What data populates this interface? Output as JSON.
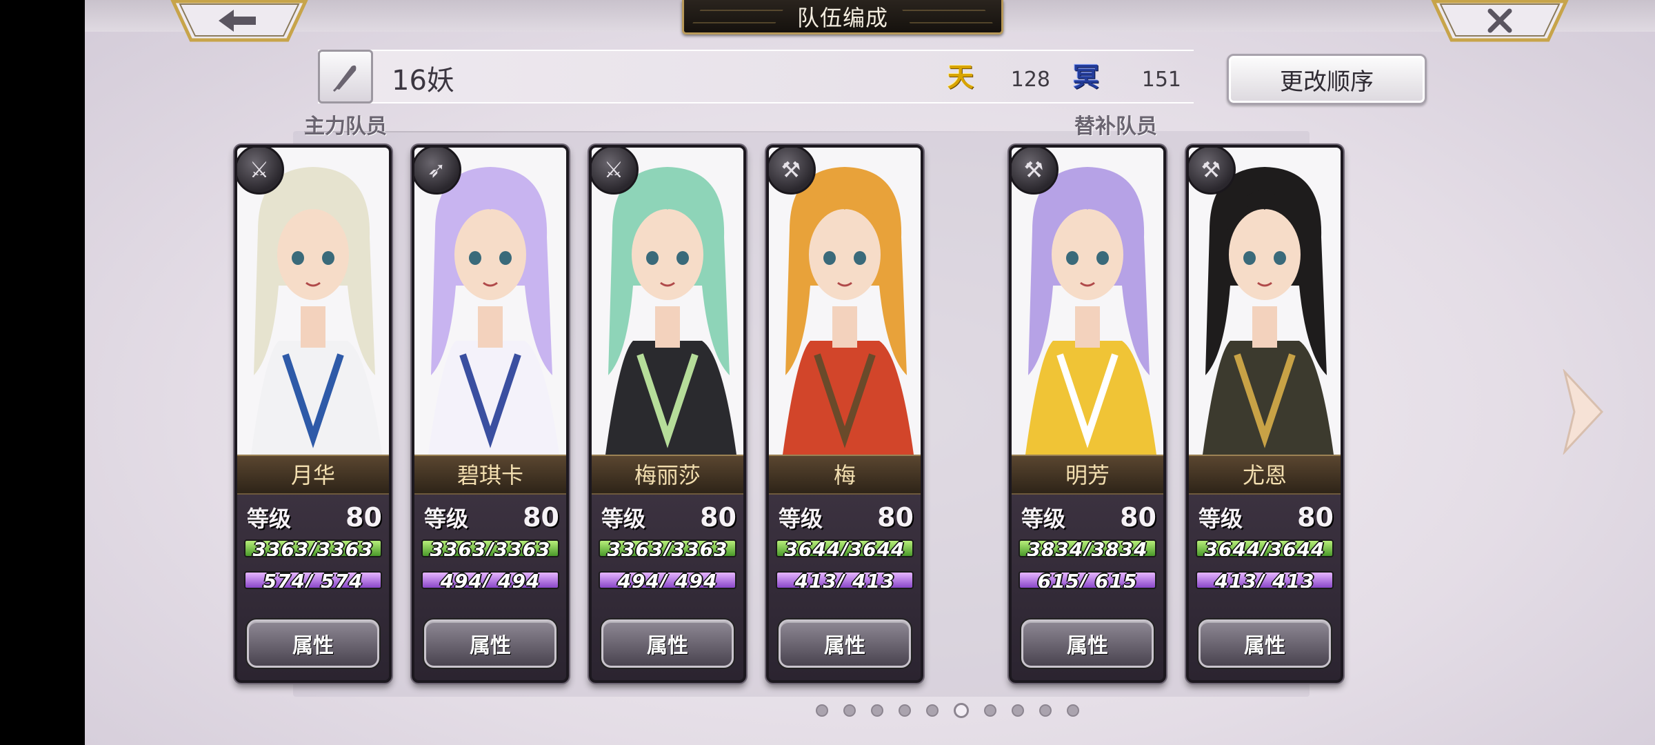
{
  "header": {
    "title": "队伍编成"
  },
  "team": {
    "name": "16妖",
    "heaven_icon": "天",
    "heaven_value": "128",
    "dark_icon": "冥",
    "dark_value": "151",
    "change_order_label": "更改顺序"
  },
  "sections": {
    "main_label": "主力队员",
    "sub_label": "替补队员"
  },
  "characters": [
    {
      "name": "月华",
      "level_label": "等级",
      "level": "80",
      "hp": "3363/3363",
      "hp_pct": 100,
      "mp": "574/ 574",
      "mp_pct": 100,
      "button": "属性",
      "weapon": "sword-icon",
      "hair": "#e6e3cf",
      "outfit": "#f2f2f4",
      "accent": "#2e5aa8"
    },
    {
      "name": "碧琪卡",
      "level_label": "等级",
      "level": "80",
      "hp": "3363/3363",
      "hp_pct": 100,
      "mp": "494/ 494",
      "mp_pct": 100,
      "button": "属性",
      "weapon": "bow-icon",
      "hair": "#c8b4f0",
      "outfit": "#f4f2fa",
      "accent": "#3a4fa0"
    },
    {
      "name": "梅丽莎",
      "level_label": "等级",
      "level": "80",
      "hp": "3363/3363",
      "hp_pct": 100,
      "mp": "494/ 494",
      "mp_pct": 100,
      "button": "属性",
      "weapon": "sword-icon",
      "hair": "#8ed4b8",
      "outfit": "#2a2a2e",
      "accent": "#b6dd9a"
    },
    {
      "name": "梅",
      "level_label": "等级",
      "level": "80",
      "hp": "3644/3644",
      "hp_pct": 100,
      "mp": "413/ 413",
      "mp_pct": 100,
      "button": "属性",
      "weapon": "hammer-icon",
      "hair": "#e8a23a",
      "outfit": "#d2452a",
      "accent": "#6a4a2a"
    },
    {
      "name": "明芳",
      "level_label": "等级",
      "level": "80",
      "hp": "3834/3834",
      "hp_pct": 100,
      "mp": "615/ 615",
      "mp_pct": 100,
      "button": "属性",
      "weapon": "hammer-icon",
      "hair": "#b6a2e6",
      "outfit": "#f0c436",
      "accent": "#ffffff"
    },
    {
      "name": "尤恩",
      "level_label": "等级",
      "level": "80",
      "hp": "3644/3644",
      "hp_pct": 100,
      "mp": "413/ 413",
      "mp_pct": 100,
      "button": "属性",
      "weapon": "hammer-icon",
      "hair": "#1e1c1c",
      "outfit": "#3c3a2e",
      "accent": "#c8a246"
    }
  ],
  "pagination": {
    "count": 10,
    "active": 5
  },
  "colors": {
    "hp": "#7acc4a",
    "mp": "#b27ae6",
    "nameplate_text": "#f3dfb0"
  }
}
